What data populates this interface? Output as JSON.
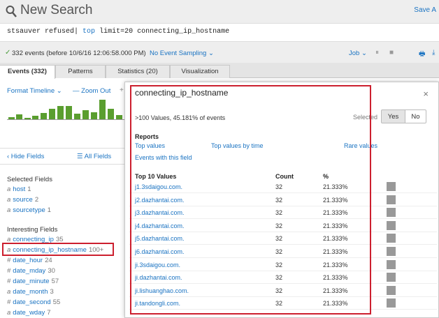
{
  "header": {
    "title": "New Search",
    "save_as": "Save A",
    "search_icon": "magnifier-icon"
  },
  "query": {
    "part1": "stsauver refused|",
    "keyword": "top",
    "part2": "limit=20 connecting_ip_hostname"
  },
  "status": {
    "check": "✓",
    "events_text": "332 events (before 10/6/16 12:06:58.000 PM)",
    "sampling": "No Event Sampling ⌄",
    "job": "Job ⌄",
    "pause": "⏸",
    "stop": "■",
    "print": "🖶",
    "export": "⤓"
  },
  "tabs": {
    "events": "Events (332)",
    "patterns": "Patterns",
    "statistics": "Statistics (20)",
    "visualization": "Visualization"
  },
  "timeline": {
    "format": "Format Timeline ⌄",
    "zoom_out": "— Zoom Out",
    "plus": "+",
    "bar_color": "#5a9e2f"
  },
  "sidebar": {
    "hide_fields": "‹ Hide Fields",
    "all_fields": "☰ All Fields",
    "selected_label": "Selected Fields",
    "interesting_label": "Interesting Fields",
    "selected": [
      {
        "type": "a",
        "name": "host",
        "count": "1"
      },
      {
        "type": "a",
        "name": "source",
        "count": "2"
      },
      {
        "type": "a",
        "name": "sourcetype",
        "count": "1"
      }
    ],
    "interesting": [
      {
        "type": "a",
        "name": "connecting_ip",
        "count": "35"
      },
      {
        "type": "a",
        "name": "connecting_ip_hostname",
        "count": "100+"
      },
      {
        "type": "#",
        "name": "date_hour",
        "count": "24"
      },
      {
        "type": "#",
        "name": "date_mday",
        "count": "30"
      },
      {
        "type": "#",
        "name": "date_minute",
        "count": "57"
      },
      {
        "type": "a",
        "name": "date_month",
        "count": "3"
      },
      {
        "type": "#",
        "name": "date_second",
        "count": "55"
      },
      {
        "type": "a",
        "name": "date_wday",
        "count": "7"
      }
    ]
  },
  "popup": {
    "title": "connecting_ip_hostname",
    "close": "×",
    "summary": ">100 Values, 45.181% of events",
    "selected_label": "Selected",
    "yes": "Yes",
    "no": "No",
    "reports_label": "Reports",
    "reports": {
      "top_values": "Top values",
      "top_values_by_time": "Top values by time",
      "rare_values": "Rare values",
      "events_with_field": "Events with this field"
    },
    "table_headers": {
      "value": "Top 10 Values",
      "count": "Count",
      "pct": "%"
    },
    "rows": [
      {
        "value": "j1.3sdaigou.com.",
        "count": "32",
        "pct": "21.333%",
        "fill": 1
      },
      {
        "value": "j2.dazhantai.com.",
        "count": "32",
        "pct": "21.333%",
        "fill": 1
      },
      {
        "value": "j3.dazhantai.com.",
        "count": "32",
        "pct": "21.333%",
        "fill": 1
      },
      {
        "value": "j4.dazhantai.com.",
        "count": "32",
        "pct": "21.333%",
        "fill": 1
      },
      {
        "value": "j5.dazhantai.com.",
        "count": "32",
        "pct": "21.333%",
        "fill": 1
      },
      {
        "value": "j6.dazhantai.com.",
        "count": "32",
        "pct": "21.333%",
        "fill": 1
      },
      {
        "value": "ji.3sdaigou.com.",
        "count": "32",
        "pct": "21.333%",
        "fill": 1
      },
      {
        "value": "ji.dazhantai.com.",
        "count": "32",
        "pct": "21.333%",
        "fill": 1
      },
      {
        "value": "ji.lishuanghao.com.",
        "count": "32",
        "pct": "21.333%",
        "fill": 1
      },
      {
        "value": "ji.tandongli.com.",
        "count": "32",
        "pct": "21.333%",
        "fill": 1
      }
    ],
    "bar_color": "#999999"
  },
  "right_edge": [
    "1",
    "1",
    "1",
    "1",
    "1",
    "1",
    "1",
    "1"
  ],
  "highlight_color": "#cc1f2e"
}
